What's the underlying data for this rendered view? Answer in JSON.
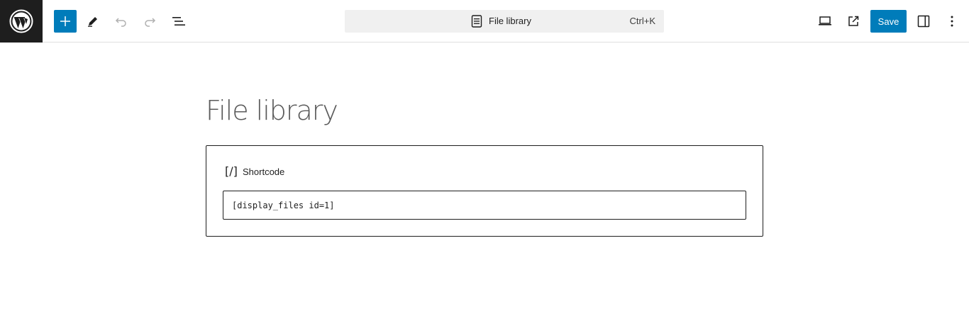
{
  "header": {
    "logo_icon": "wordpress-logo-icon",
    "toolbar": {
      "inserter_icon": "plus-icon",
      "tools_icon": "pencil-icon",
      "undo_icon": "undo-icon",
      "redo_icon": "redo-icon",
      "document_overview_icon": "list-view-icon"
    },
    "command_bar": {
      "icon": "page-icon",
      "title": "File library",
      "shortcut": "Ctrl+K"
    },
    "actions": {
      "preview_icon": "desktop-icon",
      "view_post_icon": "external-link-icon",
      "save_label": "Save",
      "settings_icon": "sidebar-icon",
      "options_icon": "more-vertical-icon"
    }
  },
  "editor": {
    "post_title": "File library",
    "shortcode_block": {
      "icon_glyph": "[/]",
      "label": "Shortcode",
      "value": "[display_files id=1]"
    }
  },
  "colors": {
    "accent": "#007cba",
    "dark": "#1e1e1e",
    "command_bar_bg": "#f0f0f0",
    "title_color": "#5a5a5a"
  }
}
